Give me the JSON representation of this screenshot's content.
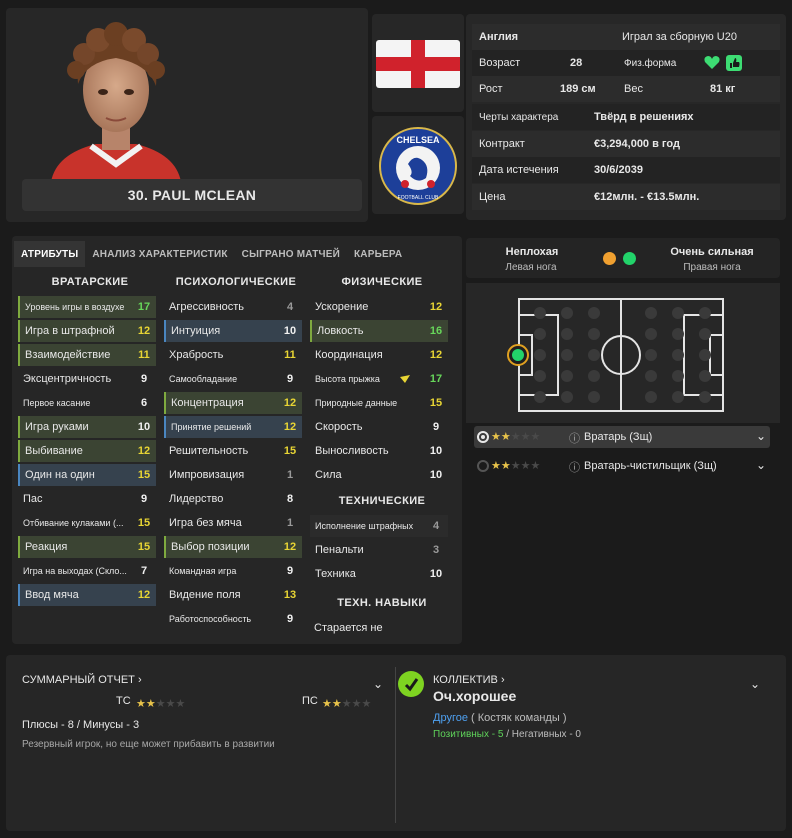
{
  "player": {
    "name": "30. PAUL MCLEAN"
  },
  "info": {
    "nation": "Англия",
    "intl": "Играл за сборную U20",
    "age_label": "Возраст",
    "age": "28",
    "fitness_label": "Физ.форма",
    "height_label": "Рост",
    "height": "189 см",
    "weight_label": "Вес",
    "weight": "81 кг",
    "traits_label": "Черты характера",
    "traits": "Твёрд в решениях",
    "contract_label": "Контракт",
    "contract": "€3,294,000 в год",
    "expiry_label": "Дата истечения",
    "expiry": "30/6/2039",
    "price_label": "Цена",
    "price": "€12млн. - €13.5млн."
  },
  "club": {
    "badge_text": "CHELSEA",
    "badge_sub": "FOOTBALL CLUB"
  },
  "tabs": [
    "АТРИБУТЫ",
    "АНАЛИЗ ХАРАКТЕРИСТИК",
    "СЫГРАНО МАТЧЕЙ",
    "КАРЬЕРА"
  ],
  "columns": {
    "gk_title": "ВРАТАРСКИЕ",
    "mental_title": "ПСИХОЛОГИЧЕСКИЕ",
    "physical_title": "ФИЗИЧЕСКИЕ",
    "technical_title": "ТЕХНИЧЕСКИЕ",
    "tech_skills_title": "ТЕХН. НАВЫКИ"
  },
  "gk": [
    {
      "label": "Уровень игры в воздухе",
      "value": "17"
    },
    {
      "label": "Игра в штрафной",
      "value": "12"
    },
    {
      "label": "Взаимодействие",
      "value": "11"
    },
    {
      "label": "Эксцентричность",
      "value": "9"
    },
    {
      "label": "Первое касание",
      "value": "6"
    },
    {
      "label": "Игра руками",
      "value": "10"
    },
    {
      "label": "Выбивание",
      "value": "12"
    },
    {
      "label": "Один на один",
      "value": "15"
    },
    {
      "label": "Пас",
      "value": "9"
    },
    {
      "label": "Отбивание кулаками (...",
      "value": "15"
    },
    {
      "label": "Реакция",
      "value": "15"
    },
    {
      "label": "Игра на выходах (Скло...",
      "value": "7"
    },
    {
      "label": "Ввод мяча",
      "value": "12"
    }
  ],
  "mental": [
    {
      "label": "Агрессивность",
      "value": "4"
    },
    {
      "label": "Интуиция",
      "value": "10"
    },
    {
      "label": "Храбрость",
      "value": "11"
    },
    {
      "label": "Самообладание",
      "value": "9"
    },
    {
      "label": "Концентрация",
      "value": "12"
    },
    {
      "label": "Принятие решений",
      "value": "12"
    },
    {
      "label": "Решительность",
      "value": "15"
    },
    {
      "label": "Импровизация",
      "value": "1"
    },
    {
      "label": "Лидерство",
      "value": "8"
    },
    {
      "label": "Игра без мяча",
      "value": "1"
    },
    {
      "label": "Выбор позиции",
      "value": "12"
    },
    {
      "label": "Командная игра",
      "value": "9"
    },
    {
      "label": "Видение поля",
      "value": "13"
    },
    {
      "label": "Работоспособность",
      "value": "9"
    }
  ],
  "physical": [
    {
      "label": "Ускорение",
      "value": "12"
    },
    {
      "label": "Ловкость",
      "value": "16"
    },
    {
      "label": "Координация",
      "value": "12"
    },
    {
      "label": "Высота прыжка",
      "value": "17"
    },
    {
      "label": "Природные данные",
      "value": "15"
    },
    {
      "label": "Скорость",
      "value": "9"
    },
    {
      "label": "Выносливость",
      "value": "10"
    },
    {
      "label": "Сила",
      "value": "10"
    }
  ],
  "technical": [
    {
      "label": "Исполнение штрафных",
      "value": "4"
    },
    {
      "label": "Пенальти",
      "value": "3"
    },
    {
      "label": "Техника",
      "value": "10"
    }
  ],
  "tech_skill": "Старается не",
  "feet": {
    "left_rating": "Неплохая",
    "left_label": "Левая нога",
    "right_rating": "Очень сильная",
    "right_label": "Правая нога",
    "left_color": "#f0a030",
    "right_color": "#22d36a"
  },
  "roles": [
    {
      "label": "Вратарь (Зщ)",
      "stars": 2
    },
    {
      "label": "Вратарь-чистильщик (Зщ)",
      "stars": 2
    }
  ],
  "report": {
    "title": "СУММАРНЫЙ ОТЧЕТ",
    "tc_label": "ТС",
    "tc_stars": 2,
    "pc_label": "ПС",
    "pc_stars": 2,
    "plus_minus": "Плюсы - 8 / Минусы - 3",
    "note": "Резервный игрок, но еще может прибавить в развитии"
  },
  "squad": {
    "title": "КОЛЛЕКТИВ",
    "rating": "Оч.хорошее",
    "link": "Другое",
    "role": "( Костяк команды )",
    "positive": "Позитивных - 5",
    "sep": "/",
    "negative": "Негативных - 0"
  }
}
